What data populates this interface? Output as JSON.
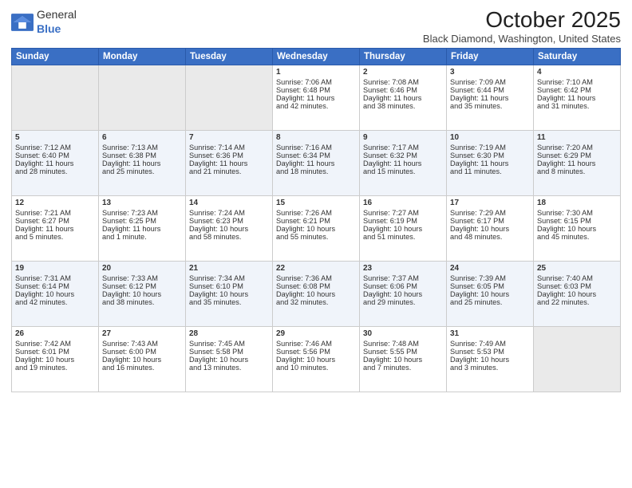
{
  "header": {
    "logo_general": "General",
    "logo_blue": "Blue",
    "month": "October 2025",
    "location": "Black Diamond, Washington, United States"
  },
  "weekdays": [
    "Sunday",
    "Monday",
    "Tuesday",
    "Wednesday",
    "Thursday",
    "Friday",
    "Saturday"
  ],
  "weeks": [
    [
      {
        "day": "",
        "info": ""
      },
      {
        "day": "",
        "info": ""
      },
      {
        "day": "",
        "info": ""
      },
      {
        "day": "1",
        "info": "Sunrise: 7:06 AM\nSunset: 6:48 PM\nDaylight: 11 hours\nand 42 minutes."
      },
      {
        "day": "2",
        "info": "Sunrise: 7:08 AM\nSunset: 6:46 PM\nDaylight: 11 hours\nand 38 minutes."
      },
      {
        "day": "3",
        "info": "Sunrise: 7:09 AM\nSunset: 6:44 PM\nDaylight: 11 hours\nand 35 minutes."
      },
      {
        "day": "4",
        "info": "Sunrise: 7:10 AM\nSunset: 6:42 PM\nDaylight: 11 hours\nand 31 minutes."
      }
    ],
    [
      {
        "day": "5",
        "info": "Sunrise: 7:12 AM\nSunset: 6:40 PM\nDaylight: 11 hours\nand 28 minutes."
      },
      {
        "day": "6",
        "info": "Sunrise: 7:13 AM\nSunset: 6:38 PM\nDaylight: 11 hours\nand 25 minutes."
      },
      {
        "day": "7",
        "info": "Sunrise: 7:14 AM\nSunset: 6:36 PM\nDaylight: 11 hours\nand 21 minutes."
      },
      {
        "day": "8",
        "info": "Sunrise: 7:16 AM\nSunset: 6:34 PM\nDaylight: 11 hours\nand 18 minutes."
      },
      {
        "day": "9",
        "info": "Sunrise: 7:17 AM\nSunset: 6:32 PM\nDaylight: 11 hours\nand 15 minutes."
      },
      {
        "day": "10",
        "info": "Sunrise: 7:19 AM\nSunset: 6:30 PM\nDaylight: 11 hours\nand 11 minutes."
      },
      {
        "day": "11",
        "info": "Sunrise: 7:20 AM\nSunset: 6:29 PM\nDaylight: 11 hours\nand 8 minutes."
      }
    ],
    [
      {
        "day": "12",
        "info": "Sunrise: 7:21 AM\nSunset: 6:27 PM\nDaylight: 11 hours\nand 5 minutes."
      },
      {
        "day": "13",
        "info": "Sunrise: 7:23 AM\nSunset: 6:25 PM\nDaylight: 11 hours\nand 1 minute."
      },
      {
        "day": "14",
        "info": "Sunrise: 7:24 AM\nSunset: 6:23 PM\nDaylight: 10 hours\nand 58 minutes."
      },
      {
        "day": "15",
        "info": "Sunrise: 7:26 AM\nSunset: 6:21 PM\nDaylight: 10 hours\nand 55 minutes."
      },
      {
        "day": "16",
        "info": "Sunrise: 7:27 AM\nSunset: 6:19 PM\nDaylight: 10 hours\nand 51 minutes."
      },
      {
        "day": "17",
        "info": "Sunrise: 7:29 AM\nSunset: 6:17 PM\nDaylight: 10 hours\nand 48 minutes."
      },
      {
        "day": "18",
        "info": "Sunrise: 7:30 AM\nSunset: 6:15 PM\nDaylight: 10 hours\nand 45 minutes."
      }
    ],
    [
      {
        "day": "19",
        "info": "Sunrise: 7:31 AM\nSunset: 6:14 PM\nDaylight: 10 hours\nand 42 minutes."
      },
      {
        "day": "20",
        "info": "Sunrise: 7:33 AM\nSunset: 6:12 PM\nDaylight: 10 hours\nand 38 minutes."
      },
      {
        "day": "21",
        "info": "Sunrise: 7:34 AM\nSunset: 6:10 PM\nDaylight: 10 hours\nand 35 minutes."
      },
      {
        "day": "22",
        "info": "Sunrise: 7:36 AM\nSunset: 6:08 PM\nDaylight: 10 hours\nand 32 minutes."
      },
      {
        "day": "23",
        "info": "Sunrise: 7:37 AM\nSunset: 6:06 PM\nDaylight: 10 hours\nand 29 minutes."
      },
      {
        "day": "24",
        "info": "Sunrise: 7:39 AM\nSunset: 6:05 PM\nDaylight: 10 hours\nand 25 minutes."
      },
      {
        "day": "25",
        "info": "Sunrise: 7:40 AM\nSunset: 6:03 PM\nDaylight: 10 hours\nand 22 minutes."
      }
    ],
    [
      {
        "day": "26",
        "info": "Sunrise: 7:42 AM\nSunset: 6:01 PM\nDaylight: 10 hours\nand 19 minutes."
      },
      {
        "day": "27",
        "info": "Sunrise: 7:43 AM\nSunset: 6:00 PM\nDaylight: 10 hours\nand 16 minutes."
      },
      {
        "day": "28",
        "info": "Sunrise: 7:45 AM\nSunset: 5:58 PM\nDaylight: 10 hours\nand 13 minutes."
      },
      {
        "day": "29",
        "info": "Sunrise: 7:46 AM\nSunset: 5:56 PM\nDaylight: 10 hours\nand 10 minutes."
      },
      {
        "day": "30",
        "info": "Sunrise: 7:48 AM\nSunset: 5:55 PM\nDaylight: 10 hours\nand 7 minutes."
      },
      {
        "day": "31",
        "info": "Sunrise: 7:49 AM\nSunset: 5:53 PM\nDaylight: 10 hours\nand 3 minutes."
      },
      {
        "day": "",
        "info": ""
      }
    ]
  ]
}
